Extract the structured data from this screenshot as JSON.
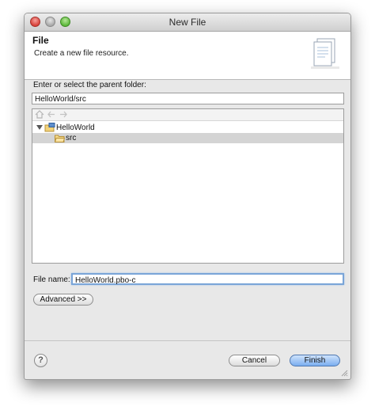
{
  "window": {
    "title": "New File"
  },
  "header": {
    "title": "File",
    "description": "Create a new file resource.",
    "icon": "new-file-document-icon"
  },
  "folder": {
    "label": "Enter or select the parent folder:",
    "value": "HelloWorld/src"
  },
  "tree_toolbar": {
    "icons": [
      "home-icon",
      "back-arrow-icon",
      "forward-arrow-icon"
    ]
  },
  "tree": {
    "items": [
      {
        "label": "HelloWorld",
        "icon": "project-folder-icon",
        "expanded": true,
        "selected": false
      },
      {
        "label": "src",
        "icon": "source-folder-icon",
        "expanded": false,
        "selected": true
      }
    ]
  },
  "filename": {
    "label": "File name:",
    "value": "HelloWorld.pbo-c"
  },
  "buttons": {
    "advanced": "Advanced >>",
    "help": "?",
    "cancel": "Cancel",
    "finish": "Finish"
  },
  "colors": {
    "finish_button": "#7aaef0",
    "focus_ring": "#7aa5d8",
    "selection": "#d4d4d4"
  }
}
